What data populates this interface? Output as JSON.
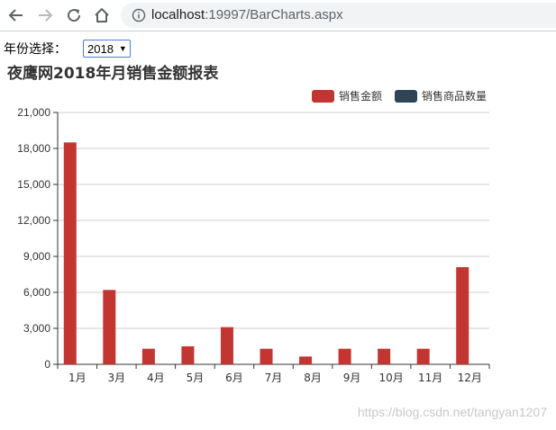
{
  "browser": {
    "url_host": "localhost",
    "url_path": ":19997/BarCharts.aspx"
  },
  "filter": {
    "label": "年份选择：",
    "selected_year": "2018"
  },
  "watermark": "https://blog.csdn.net/tangyan1207",
  "colors": {
    "sales_amount": "#c23531",
    "sales_quantity": "#2f4554",
    "grid": "#cccccc",
    "axis": "#333333",
    "title": "#333333"
  },
  "chart_data": {
    "type": "bar",
    "title": "夜鹰网2018年月销售金额报表",
    "categories": [
      "1月",
      "3月",
      "4月",
      "5月",
      "6月",
      "7月",
      "8月",
      "9月",
      "10月",
      "11月",
      "12月"
    ],
    "series": [
      {
        "name": "销售金额",
        "values": [
          18500,
          6200,
          1300,
          1500,
          3100,
          1300,
          650,
          1300,
          1300,
          1300,
          8100
        ]
      },
      {
        "name": "销售商品数量",
        "values": [
          0,
          0,
          0,
          0,
          0,
          0,
          0,
          0,
          0,
          0,
          0
        ]
      }
    ],
    "ylim": [
      0,
      21000
    ],
    "yticks": [
      0,
      3000,
      6000,
      9000,
      12000,
      15000,
      18000,
      21000
    ],
    "ytick_labels": [
      "0",
      "3,000",
      "6,000",
      "9,000",
      "12,000",
      "15,000",
      "18,000",
      "21,000"
    ],
    "grid": true,
    "legend_position": "top-right"
  }
}
